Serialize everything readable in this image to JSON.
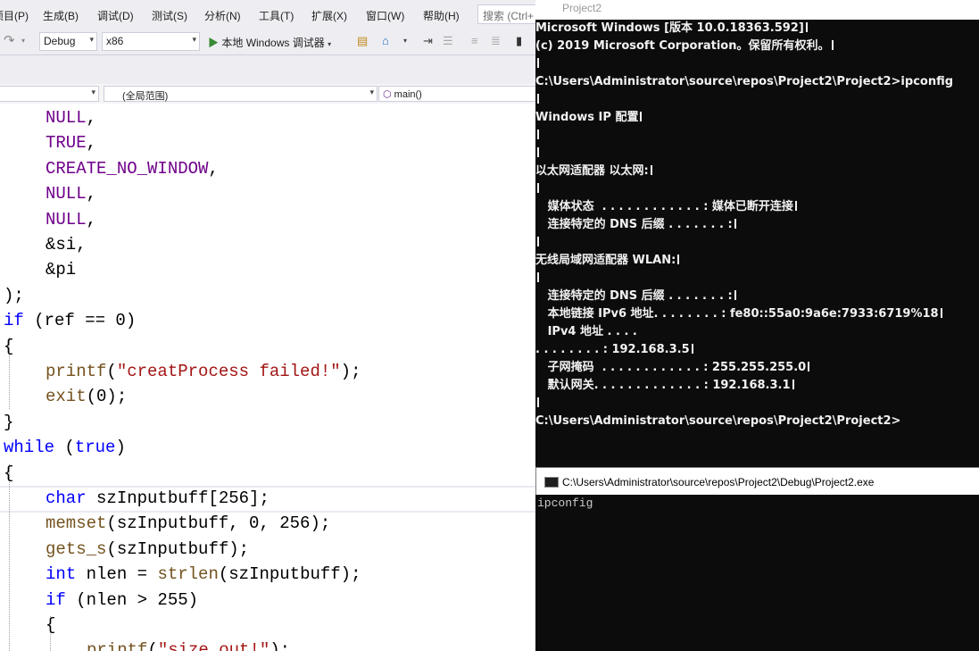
{
  "vs": {
    "menu": [
      "项目(P)",
      "生成(B)",
      "调试(D)",
      "测试(S)",
      "分析(N)",
      "工具(T)",
      "扩展(X)",
      "窗口(W)",
      "帮助(H)"
    ],
    "search_placeholder": "搜索 (Ctrl+",
    "toolbar": {
      "config": "Debug",
      "platform": "x86",
      "run_label": "本地 Windows 调试器"
    },
    "nav": {
      "project_combo": "",
      "scope": "(全局范围)",
      "function": "main()"
    },
    "code_lines": [
      {
        "indent": 1,
        "tokens": [
          {
            "t": "NULL",
            "c": "cst"
          },
          {
            "t": ",",
            "c": ""
          }
        ]
      },
      {
        "indent": 1,
        "tokens": [
          {
            "t": "TRUE",
            "c": "cst"
          },
          {
            "t": ",",
            "c": ""
          }
        ]
      },
      {
        "indent": 1,
        "tokens": [
          {
            "t": "CREATE_NO_WINDOW",
            "c": "cst"
          },
          {
            "t": ",",
            "c": ""
          }
        ]
      },
      {
        "indent": 1,
        "tokens": [
          {
            "t": "NULL",
            "c": "cst"
          },
          {
            "t": ",",
            "c": ""
          }
        ]
      },
      {
        "indent": 1,
        "tokens": [
          {
            "t": "NULL",
            "c": "cst"
          },
          {
            "t": ",",
            "c": ""
          }
        ]
      },
      {
        "indent": 1,
        "tokens": [
          {
            "t": "&si,",
            "c": ""
          }
        ]
      },
      {
        "indent": 1,
        "tokens": [
          {
            "t": "&pi",
            "c": ""
          }
        ]
      },
      {
        "indent": 0,
        "tokens": [
          {
            "t": ");",
            "c": ""
          }
        ]
      },
      {
        "indent": 0,
        "tokens": [
          {
            "t": "if",
            "c": "kw"
          },
          {
            "t": " (ref == 0)",
            "c": ""
          }
        ]
      },
      {
        "indent": 0,
        "tokens": [
          {
            "t": "{",
            "c": ""
          }
        ]
      },
      {
        "indent": 1,
        "tokens": [
          {
            "t": "printf",
            "c": "fn"
          },
          {
            "t": "(",
            "c": ""
          },
          {
            "t": "\"creatProcess failed!\"",
            "c": "str"
          },
          {
            "t": ");",
            "c": ""
          }
        ]
      },
      {
        "indent": 1,
        "tokens": [
          {
            "t": "exit",
            "c": "fn"
          },
          {
            "t": "(0);",
            "c": ""
          }
        ]
      },
      {
        "indent": 0,
        "tokens": [
          {
            "t": "}",
            "c": ""
          }
        ]
      },
      {
        "indent": 0,
        "tokens": [
          {
            "t": "while",
            "c": "kw"
          },
          {
            "t": " (",
            "c": ""
          },
          {
            "t": "true",
            "c": "kw"
          },
          {
            "t": ")",
            "c": ""
          }
        ]
      },
      {
        "indent": 0,
        "tokens": [
          {
            "t": "{",
            "c": ""
          }
        ]
      },
      {
        "indent": 1,
        "tokens": [
          {
            "t": "char",
            "c": "kw"
          },
          {
            "t": " szInputbuff[256];",
            "c": ""
          }
        ]
      },
      {
        "indent": 1,
        "tokens": [
          {
            "t": "memset",
            "c": "fn"
          },
          {
            "t": "(szInputbuff, 0, 256);",
            "c": ""
          }
        ]
      },
      {
        "indent": 1,
        "tokens": [
          {
            "t": "gets_s",
            "c": "fn"
          },
          {
            "t": "(szInputbuff);",
            "c": ""
          }
        ]
      },
      {
        "indent": 1,
        "tokens": [
          {
            "t": "int",
            "c": "kw"
          },
          {
            "t": " nlen = ",
            "c": ""
          },
          {
            "t": "strlen",
            "c": "fn"
          },
          {
            "t": "(szInputbuff);",
            "c": ""
          }
        ]
      },
      {
        "indent": 1,
        "tokens": [
          {
            "t": "if",
            "c": "kw"
          },
          {
            "t": " (nlen > 255)",
            "c": ""
          }
        ]
      },
      {
        "indent": 1,
        "tokens": [
          {
            "t": "{",
            "c": ""
          }
        ]
      },
      {
        "indent": 2,
        "tokens": [
          {
            "t": "printf",
            "c": "fn"
          },
          {
            "t": "(",
            "c": ""
          },
          {
            "t": "\"size out!\"",
            "c": "str"
          },
          {
            "t": ");",
            "c": ""
          }
        ]
      }
    ]
  },
  "console1": {
    "title": "Project2",
    "lines": [
      "Microsoft Windows [版本 10.0.18363.592]",
      "(c) 2019 Microsoft Corporation。保留所有权利。",
      "",
      "C:\\Users\\Administrator\\source\\repos\\Project2\\Project2>ipconfig",
      "",
      "Windows IP 配置",
      "",
      "",
      "以太网适配器 以太网:",
      "",
      "   媒体状态  . . . . . . . . . . . . : 媒体已断开连接",
      "   连接特定的 DNS 后缀 . . . . . . . :",
      "",
      "无线局域网适配器 WLAN:",
      "",
      "   连接特定的 DNS 后缀 . . . . . . . :",
      "   本地链接 IPv6 地址. . . . . . . . : fe80::55a0:9a6e:7933:6719%18",
      "   IPv4 地址 . . . .",
      ". . . . . . . . : 192.168.3.5",
      "   子网掩码  . . . . . . . . . . . . : 255.255.255.0",
      "   默认网关. . . . . . . . . . . . . : 192.168.3.1",
      "",
      "C:\\Users\\Administrator\\source\\repos\\Project2\\Project2>"
    ],
    "cursor_lines": [
      0,
      1,
      2,
      4,
      5,
      6,
      7,
      8,
      9,
      10,
      11,
      12,
      13,
      14,
      15,
      16,
      18,
      19,
      20,
      21
    ]
  },
  "console2": {
    "title": "C:\\Users\\Administrator\\source\\repos\\Project2\\Debug\\Project2.exe",
    "text": "ipconfig"
  }
}
